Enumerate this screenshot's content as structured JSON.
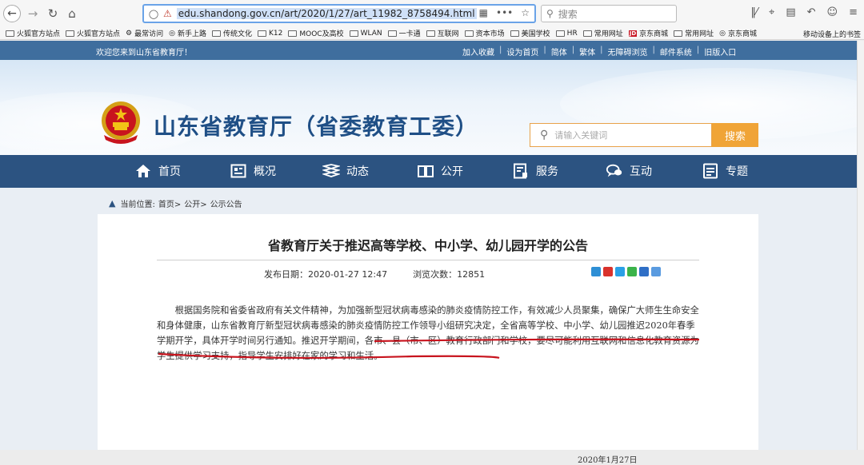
{
  "browser": {
    "url": "edu.shandong.gov.cn/art/2020/1/27/art_11982_8758494.html",
    "search_placeholder": "搜索",
    "bookmarks": [
      {
        "label": "火狐官方站点",
        "icon": "folder-icon"
      },
      {
        "label": "火狐官方站点",
        "icon": "folder-icon"
      },
      {
        "label": "最常访问",
        "icon": "gear-icon"
      },
      {
        "label": "新手上路",
        "icon": "globe-icon"
      },
      {
        "label": "传统文化",
        "icon": "folder-icon"
      },
      {
        "label": "K12",
        "icon": "folder-icon"
      },
      {
        "label": "MOOC及高校",
        "icon": "folder-icon"
      },
      {
        "label": "WLAN",
        "icon": "folder-icon"
      },
      {
        "label": "一卡通",
        "icon": "folder-icon"
      },
      {
        "label": "互联网",
        "icon": "folder-icon"
      },
      {
        "label": "资本市场",
        "icon": "folder-icon"
      },
      {
        "label": "美国学校",
        "icon": "folder-icon"
      },
      {
        "label": "HR",
        "icon": "folder-icon"
      },
      {
        "label": "常用网址",
        "icon": "folder-icon"
      },
      {
        "label": "京东商城",
        "icon": "jd-icon"
      },
      {
        "label": "常用网址",
        "icon": "folder-icon"
      },
      {
        "label": "京东商城",
        "icon": "globe-icon"
      }
    ],
    "mobile_bookmarks": "移动设备上的书签"
  },
  "site": {
    "welcome": "欢迎您来到山东省教育厅！",
    "top_links": [
      "加入收藏",
      "设为首页",
      "简体",
      "繁体",
      "无障碍浏览",
      "邮件系统",
      "旧版入口"
    ],
    "title": "山东省教育厅（省委教育工委）",
    "search_placeholder": "请输入关键词",
    "search_button": "搜索",
    "nav": [
      {
        "label": "首页",
        "icon": "home-icon"
      },
      {
        "label": "概况",
        "icon": "overview-icon"
      },
      {
        "label": "动态",
        "icon": "news-icon"
      },
      {
        "label": "公开",
        "icon": "book-icon"
      },
      {
        "label": "服务",
        "icon": "service-icon"
      },
      {
        "label": "互动",
        "icon": "chat-icon"
      },
      {
        "label": "专题",
        "icon": "topic-icon"
      }
    ],
    "breadcrumb": {
      "prefix": "当前位置:",
      "items": [
        "首页>",
        "公开>",
        "公示公告"
      ]
    },
    "colors": {
      "top_strip": "#3f6e9e",
      "nav": "#2c5381",
      "title": "#1f4f86",
      "search_button": "#f0a437",
      "underline": "#c8141e"
    }
  },
  "article": {
    "title": "省教育厅关于推迟高等学校、中小学、幼儿园开学的公告",
    "publish_date": "发布日期：2020-01-27 12:47",
    "views": "浏览次数：12851",
    "body": "根据国务院和省委省政府有关文件精神，为加强新型冠状病毒感染的肺炎疫情防控工作，有效减少人员聚集，确保广大师生生命安全和身体健康，山东省教育厅新型冠状病毒感染的肺炎疫情防控工作领导小组研究决定，全省高等学校、中小学、幼儿园推迟2020年春季学期开学，具体开学时间另行通知。推迟开学期间，各市、县（市、区）教育行政部门和学校，要尽可能利用互联网和信息化教育资源为学生提供学习支持，指导学生安排好在家的学习和生活。",
    "signed_date": "2020年1月27日"
  }
}
